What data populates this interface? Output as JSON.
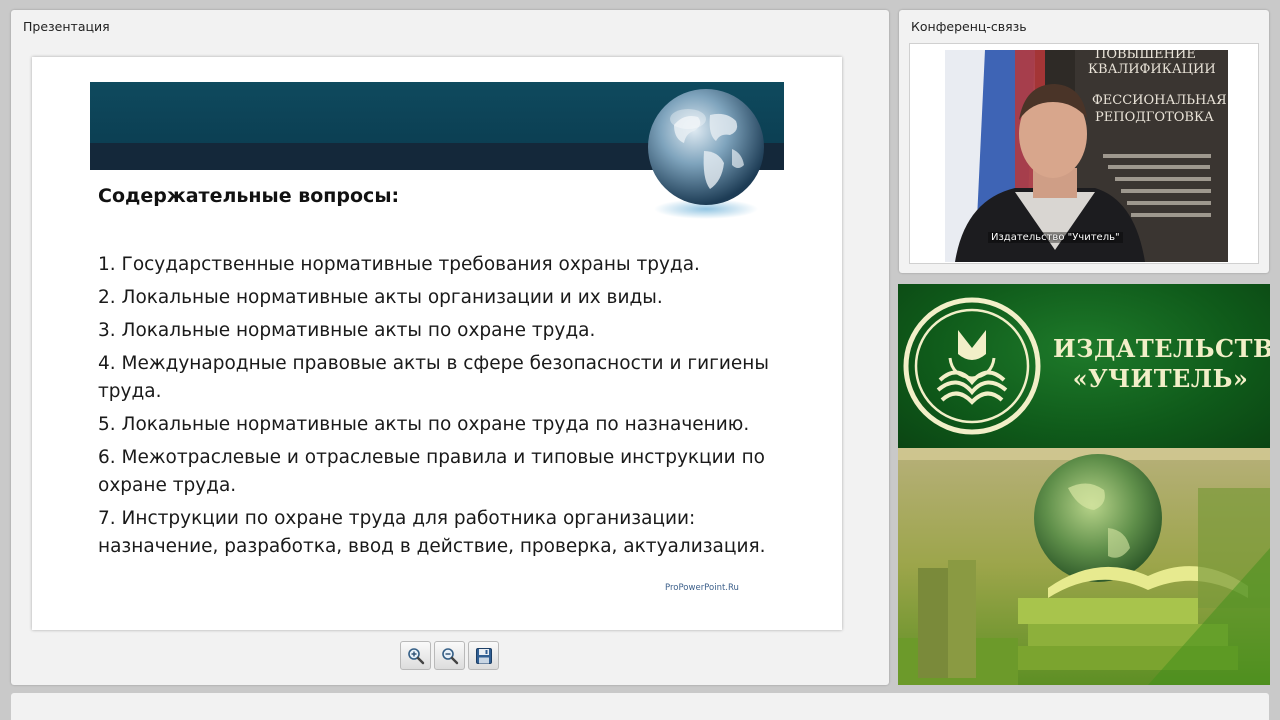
{
  "presentation": {
    "title": "Презентация",
    "slide": {
      "heading": "Содержательные вопросы:",
      "items": [
        "1. Государственные нормативные требования охраны труда.",
        "2. Локальные нормативные акты организации и их виды.",
        "3. Локальные нормативные акты по охране труда.",
        "4. Международные правовые акты в сфере безопасности и гигиены труда.",
        "5. Локальные нормативные акты по охране труда по назначению.",
        "6. Межотраслевые и отраслевые правила и типовые инструкции по охране труда.",
        "7. Инструкции по охране труда для работника организации: назначение, разработка, ввод в действие, проверка, актуализация."
      ],
      "credit": "ProPowerPoint.Ru"
    },
    "toolbar": {
      "zoom_in_icon": "zoom-in-icon",
      "zoom_out_icon": "zoom-out-icon",
      "save_icon": "save-icon"
    }
  },
  "conference": {
    "title": "Конференц-связь",
    "caption": "Издательство \"Учитель\"",
    "backdrop_lines": [
      "ПОВЫШЕНИЕ",
      "КВАЛИФИКАЦИИ",
      "ФЕССИОНАЛЬНАЯ",
      "РЕПОДГОТОВКА"
    ]
  },
  "banner": {
    "line1": "ИЗДАТЕЛЬСТВО",
    "line2": "«УЧИТЕЛЬ»"
  },
  "colors": {
    "band": "#0e4a5e",
    "band_dark": "#14283a",
    "brand_green": "#136b20",
    "brand_text": "#f2efc8"
  }
}
